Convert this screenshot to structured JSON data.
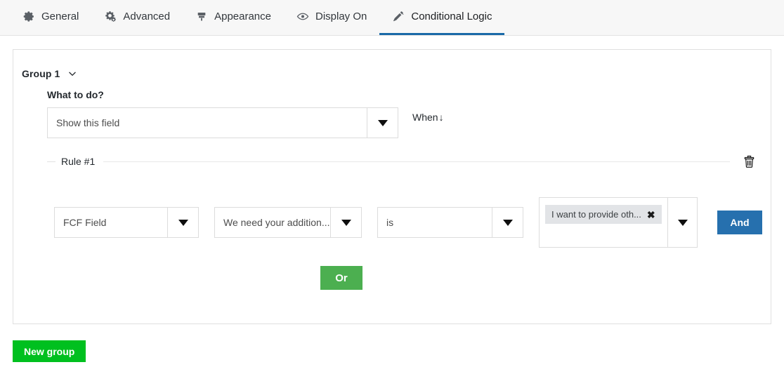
{
  "tabs": [
    {
      "label": "General",
      "icon": "gear-icon",
      "active": false
    },
    {
      "label": "Advanced",
      "icon": "gears-icon",
      "active": false
    },
    {
      "label": "Appearance",
      "icon": "brush-icon",
      "active": false
    },
    {
      "label": "Display On",
      "icon": "eye-icon",
      "active": false
    },
    {
      "label": "Conditional Logic",
      "icon": "magic-wand-icon",
      "active": true
    }
  ],
  "group": {
    "title": "Group 1",
    "toggle_icon": "chevron-down-icon",
    "what_to_do_label": "What to do?",
    "action_value": "Show this field",
    "when_label": "When",
    "when_arrow": "↓"
  },
  "rule": {
    "legend": "Rule #1",
    "delete_icon": "trash-icon",
    "field_value": "FCF Field",
    "subfield_value": "We need your addition...",
    "operator_value": "is",
    "selected_chip": "I want to provide oth...",
    "chip_remove_icon": "close-icon",
    "and_label": "And"
  },
  "footer": {
    "or_label": "Or",
    "new_group_label": "New group"
  },
  "colors": {
    "active_tab_underline": "#1a6aa8",
    "and_button": "#2670ae",
    "or_button": "#4caf50",
    "new_group_button": "#00c01f",
    "chip_background": "#e2e4e7",
    "header_background": "#f7f7f7"
  }
}
